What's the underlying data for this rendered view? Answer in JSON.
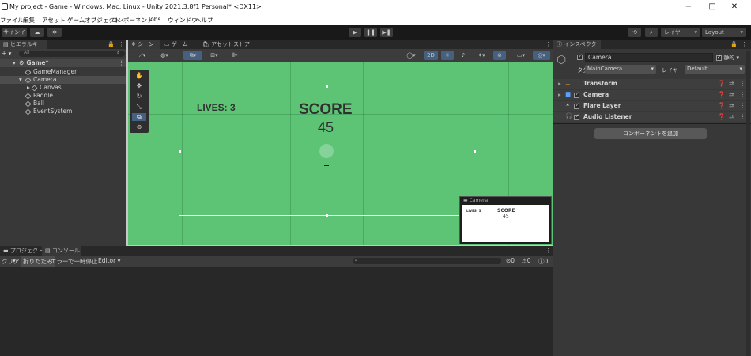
{
  "window": {
    "title": "My project - Game - Windows, Mac, Linux - Unity 2021.3.8f1 Personal* <DX11>",
    "minimize": "−",
    "maximize": "□",
    "close": "✕"
  },
  "menu": [
    "ファイル",
    "編集",
    "アセット",
    "ゲームオブジェクト",
    "コンポーネント",
    "Jobs",
    "ウィンドウ",
    "ヘルプ"
  ],
  "toolbar": {
    "account": "サインイン",
    "cloud_icon": "cloud-icon",
    "collab_icon": "collab-icon",
    "play": "▶",
    "pause": "❚❚",
    "step": "▶❚",
    "history_icon": "history-icon",
    "search_icon": "search-icon",
    "layers": "レイヤー",
    "layout": "Layout"
  },
  "hierarchy": {
    "tab": "ヒエラルキー",
    "add": "+ ▾",
    "search_placeholder": "All",
    "scene": "Game*",
    "items": [
      "GameManager",
      "Camera",
      "Canvas",
      "Paddle",
      "Ball",
      "EventSystem"
    ]
  },
  "scene_tabs": [
    "シーン",
    "ゲーム",
    "アセットストア"
  ],
  "scene_toolbar": {
    "toggle_2d": "2D"
  },
  "game": {
    "lives_label": "LIVES: 3",
    "score_label": "SCORE",
    "score_value": "45",
    "preview_title": "Camera",
    "preview_lives": "LIVES: 3",
    "preview_score": "SCORE",
    "preview_value": "45",
    "scene_color": "#5dc476"
  },
  "bottom": {
    "tabs": [
      "プロジェクト",
      "コンソール"
    ],
    "clear": "クリア",
    "collapse": "折りたたみ",
    "error_pause": "エラーで一時停止",
    "editor": "Editor ▾",
    "errors": "0",
    "warnings": "0",
    "logs": "0"
  },
  "inspector": {
    "tab": "インスペクター",
    "object_name": "Camera",
    "static_label": "静的",
    "tag_label": "タグ",
    "tag_value": "MainCamera",
    "layer_label": "レイヤー",
    "layer_value": "Default",
    "components": [
      "Transform",
      "Camera",
      "Flare Layer",
      "Audio Listener"
    ],
    "add_component": "コンポーネントを追加"
  }
}
